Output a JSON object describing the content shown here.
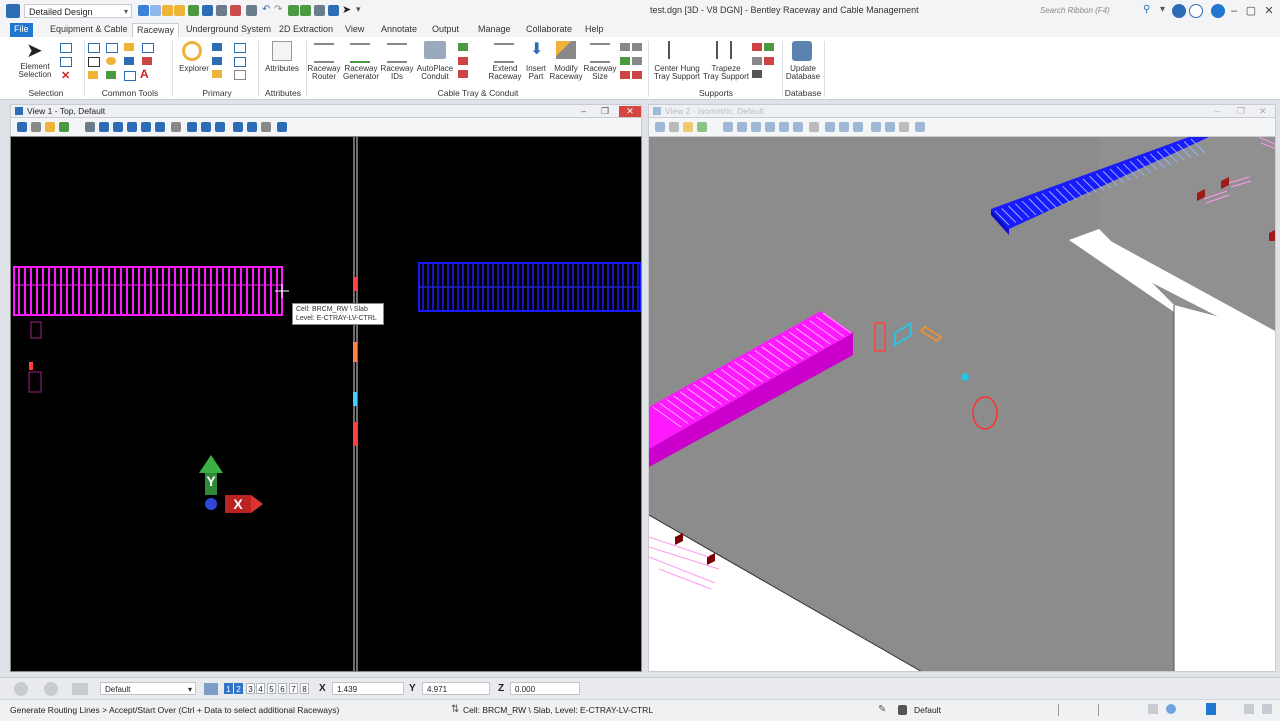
{
  "app": {
    "workflow": "Detailed Design",
    "document_title": "test.dgn [3D - V8 DGN] - Bentley Raceway and Cable Management",
    "search_placeholder": "Search Ribbon (F4)"
  },
  "tabs": [
    "File",
    "Equipment & Cable",
    "Raceway",
    "Underground System",
    "2D Extraction",
    "View",
    "Annotate",
    "Output",
    "Manage",
    "Collaborate",
    "Help"
  ],
  "active_tab": "Raceway",
  "ribbon": {
    "groups": {
      "selection": "Selection",
      "common_tools": "Common Tools",
      "primary": "Primary",
      "attributes": "Attributes",
      "cable_tray_conduit": "Cable Tray & Conduit",
      "supports": "Supports",
      "database": "Database"
    },
    "buttons": {
      "element_selection": "Element\nSelection",
      "explorer": "Explorer",
      "attributes": "Attributes",
      "raceway_router": "Raceway\nRouter",
      "raceway_generator": "Raceway\nGenerator",
      "raceway_ids": "Raceway\nIDs",
      "autoplace_conduit": "AutoPlace\nConduit",
      "extend_raceway": "Extend\nRaceway",
      "insert_part": "Insert\nPart",
      "modify_raceway": "Modify\nRaceway",
      "raceway_size": "Raceway\nSize",
      "center_hung": "Center Hung\nTray Support",
      "trapeze": "Trapeze\nTray Support",
      "update_database": "Update\nDatabase"
    }
  },
  "views": {
    "view1_title": "View 1 - Top, Default",
    "view2_title": "View 2 - Isometric, Default",
    "tooltip_line1": "Cell: BRCM_RW \\ Slab",
    "tooltip_line2": "Level: E-CTRAY-LV-CTRL",
    "axis_y": "Y",
    "axis_x": "X"
  },
  "status": {
    "model": "Default",
    "view_numbers": [
      "1",
      "2",
      "3",
      "4",
      "5",
      "6",
      "7",
      "8"
    ],
    "x_label": "X",
    "x_value": "1.439",
    "y_label": "Y",
    "y_value": "4.971",
    "z_label": "Z",
    "z_value": "0.000",
    "prompt": "Generate Routing Lines > Accept/Start Over (Ctrl + Data to select additional Raceways)",
    "element_info": "Cell: BRCM_RW \\ Slab, Level: E-CTRAY-LV-CTRL",
    "active_level": "Default"
  },
  "colors": {
    "accent": "#1f77d0",
    "magenta_tray": "#ff19ff",
    "blue_tray": "#1a1aff",
    "wall_gray": "#8a8a8a"
  }
}
